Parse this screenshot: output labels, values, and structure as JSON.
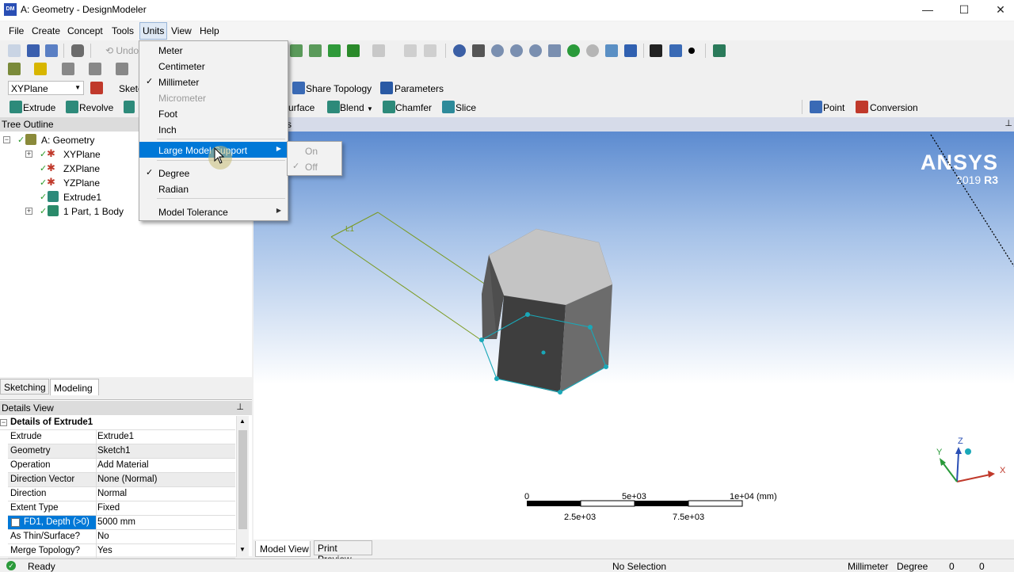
{
  "window": {
    "title": "A: Geometry - DesignModeler",
    "app_icon": "DM",
    "minimize": "—",
    "maximize": "☐",
    "close": "✕"
  },
  "menubar": [
    "File",
    "Create",
    "Concept",
    "Tools",
    "Units",
    "View",
    "Help"
  ],
  "toolbar1": {
    "undo": "Undo"
  },
  "toolbar3": {
    "plane": "XYPlane",
    "sketch": "Sketc",
    "share_topology": "Share Topology",
    "parameters": "Parameters"
  },
  "toolbar4": {
    "extrude": "Extrude",
    "revolve": "Revolve",
    "surface": "urface",
    "blend": "Blend",
    "chamfer": "Chamfer",
    "slice": "Slice",
    "point": "Point",
    "conversion": "Conversion"
  },
  "tree": {
    "header": "Tree Outline",
    "items": [
      {
        "label": "A: Geometry"
      },
      {
        "label": "XYPlane"
      },
      {
        "label": "ZXPlane"
      },
      {
        "label": "YZPlane"
      },
      {
        "label": "Extrude1"
      },
      {
        "label": "1 Part, 1 Body"
      }
    ]
  },
  "tabs": {
    "sketching": "Sketching",
    "modeling": "Modeling"
  },
  "details": {
    "header": "Details View",
    "pin": "ᵖ",
    "section": "Details of Extrude1",
    "rows": [
      {
        "label": "Extrude",
        "value": "Extrude1"
      },
      {
        "label": "Geometry",
        "value": "Sketch1"
      },
      {
        "label": "Operation",
        "value": "Add Material"
      },
      {
        "label": "Direction Vector",
        "value": "None (Normal)"
      },
      {
        "label": "Direction",
        "value": "Normal"
      },
      {
        "label": "Extent Type",
        "value": "Fixed"
      },
      {
        "label": "FD1, Depth (>0)",
        "value": "5000 mm"
      },
      {
        "label": "As Thin/Surface?",
        "value": "No"
      },
      {
        "label": "Merge Topology?",
        "value": "Yes"
      }
    ]
  },
  "units_menu": {
    "items": [
      {
        "label": "Meter",
        "checked": false,
        "disabled": false
      },
      {
        "label": "Centimeter",
        "checked": false,
        "disabled": false
      },
      {
        "label": "Millimeter",
        "checked": true,
        "disabled": false
      },
      {
        "label": "Micrometer",
        "checked": false,
        "disabled": true
      },
      {
        "label": "Foot",
        "checked": false,
        "disabled": false
      },
      {
        "label": "Inch",
        "checked": false,
        "disabled": false
      },
      {
        "label": "Large Model Support",
        "submenu": true,
        "highlighted": true
      },
      {
        "label": "Degree",
        "checked": true,
        "disabled": false
      },
      {
        "label": "Radian",
        "checked": false,
        "disabled": false
      },
      {
        "label": "Model Tolerance",
        "submenu": true
      }
    ],
    "check_glyph": "✓",
    "submenu_arrow": "▶",
    "submenu": [
      {
        "label": "On",
        "checked": false
      },
      {
        "label": "Off",
        "checked": true
      }
    ]
  },
  "viewport": {
    "header_hint": "s",
    "logo": "ANSYS",
    "version": "2019",
    "release": "R3",
    "dimension_label": "L1",
    "scale": {
      "top_labels": [
        "0",
        "5e+03",
        "1e+04 (mm)"
      ],
      "bottom_labels": [
        "2.5e+03",
        "7.5e+03"
      ]
    },
    "triad": {
      "x": "X",
      "y": "Y",
      "z": "Z"
    },
    "tabs": {
      "model_view": "Model View",
      "print_preview": "Print Preview"
    }
  },
  "statusbar": {
    "ready": "Ready",
    "selection": "No Selection",
    "length_unit": "Millimeter",
    "angle_unit": "Degree",
    "val1": "0",
    "val2": "0"
  },
  "colors": {
    "accent": "#0078d7",
    "viewport_top": "#5c8bd0",
    "solid_top": "#c8c8c8",
    "solid_dark": "#4a4a4a",
    "sketch_edges": "#1aa8b8"
  }
}
